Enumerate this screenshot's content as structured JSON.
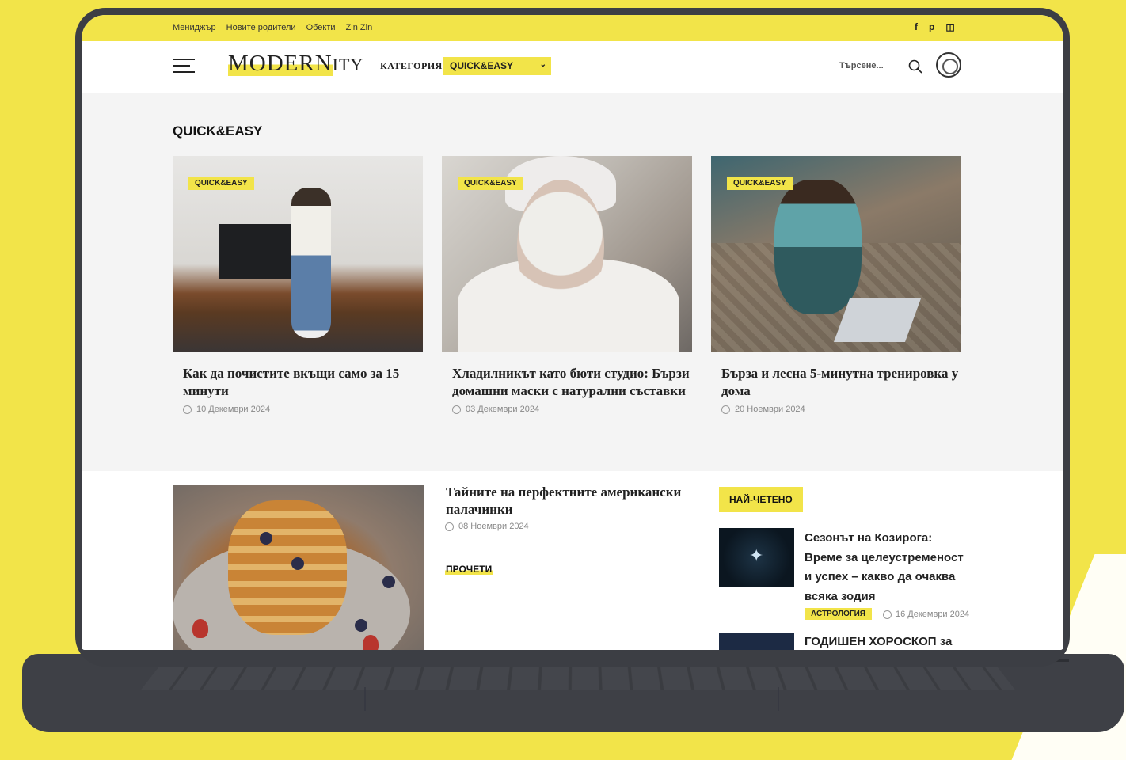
{
  "topbar": {
    "links": [
      "Мениджър",
      "Новите родители",
      "Обекти",
      "Zin Zin"
    ],
    "social": [
      "f",
      "p",
      "◫"
    ]
  },
  "nav": {
    "logo_main": "MODERN",
    "logo_tail": "ITY",
    "category_label": "КАТЕГОРИЯ:",
    "category_value": "QUICK&EASY",
    "search_placeholder": "Търсене..."
  },
  "section": {
    "title": "QUICK&EASY",
    "cards": [
      {
        "tag": "QUICK&EASY",
        "title": "Как да почистите вкъщи само за 15 минути",
        "date": "10 Декември 2024"
      },
      {
        "tag": "QUICK&EASY",
        "title": "Хладилникът като бюти студио: Бързи домашни маски с натурални съставки",
        "date": "03 Декември 2024"
      },
      {
        "tag": "QUICK&EASY",
        "title": "Бърза и лесна 5-минутна тренировка у дома",
        "date": "20 Ноември 2024"
      }
    ]
  },
  "featured": {
    "title": "Тайните на перфектните американски палачинки",
    "date": "08 Ноември 2024",
    "read_more": "ПРОЧЕТИ"
  },
  "most_read": {
    "heading": "НАЙ-ЧЕТЕНО",
    "items": [
      {
        "title": "Сезонът на Козирога: Време за целеустременост и успех – какво да очаква всяка зодия",
        "tag": "АСТРОЛОГИЯ",
        "date": "16 Декември 2024"
      },
      {
        "title": "ГОДИШЕН ХОРОСКОП за"
      }
    ]
  },
  "colors": {
    "accent": "#f2e449",
    "bezel": "#3c3e44"
  }
}
